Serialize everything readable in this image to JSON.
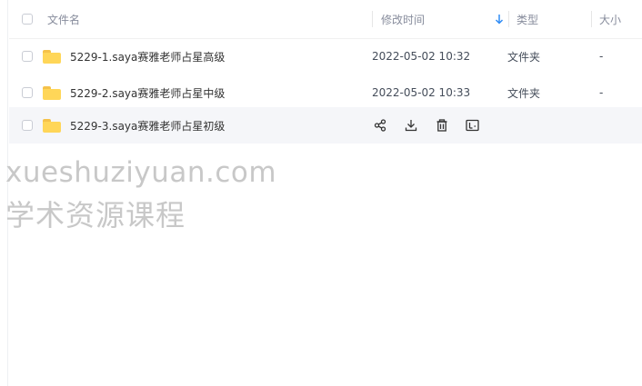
{
  "header": {
    "name_label": "文件名",
    "time_label": "修改时间",
    "sort_icon": "arrow-down-icon",
    "type_label": "类型",
    "size_label": "大小"
  },
  "files": [
    {
      "name": "5229-1.saya赛雅老师占星高级",
      "modified": "2022-05-02 10:32",
      "type": "文件夹",
      "size": "-"
    },
    {
      "name": "5229-2.saya赛雅老师占星中级",
      "modified": "2022-05-02 10:33",
      "type": "文件夹",
      "size": "-"
    },
    {
      "name": "5229-3.saya赛雅老师占星初级",
      "modified": "",
      "type": "",
      "size": ""
    }
  ],
  "row_actions": [
    "share-icon",
    "download-icon",
    "delete-icon",
    "rename-icon"
  ],
  "watermark": {
    "line1": "xueshuziyuan.com",
    "line2": "学术资源课程"
  },
  "colors": {
    "folder": "#ffd658",
    "sort_accent": "#2f8cf5",
    "hover_row": "#f5f6f9"
  }
}
